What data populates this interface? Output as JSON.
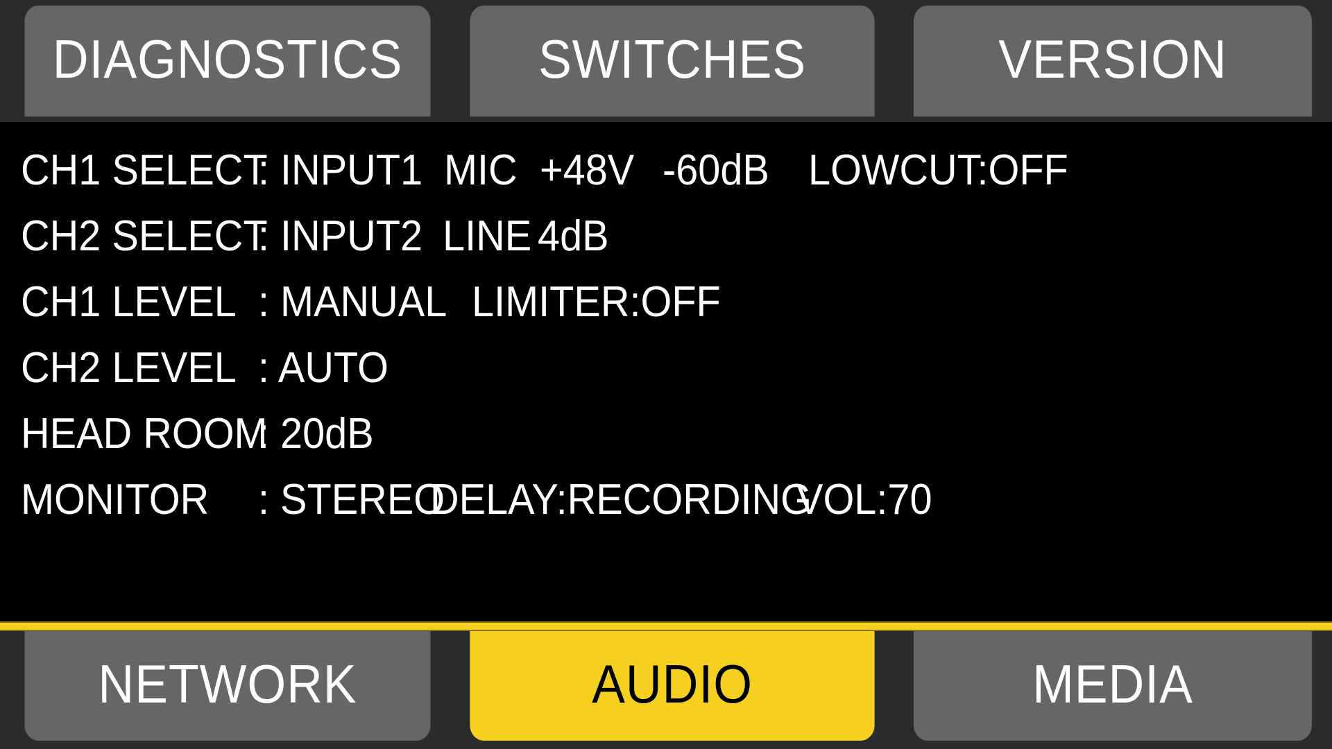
{
  "colors": {
    "panel_background": "#000000",
    "tab_inactive": "#666666",
    "tab_active": "#f5d020",
    "tab_active_text": "#000000",
    "text": "#ffffff",
    "chrome_background": "#2b2b2b",
    "divider": "#f5d020"
  },
  "top_tabs": [
    {
      "label": "DIAGNOSTICS",
      "active": false
    },
    {
      "label": "SWITCHES",
      "active": false
    },
    {
      "label": "VERSION",
      "active": false
    }
  ],
  "bottom_tabs": [
    {
      "label": "NETWORK",
      "active": false
    },
    {
      "label": "AUDIO",
      "active": true
    },
    {
      "label": "MEDIA",
      "active": false
    }
  ],
  "audio_settings": [
    {
      "label": "CH1 SELECT",
      "value": ": INPUT1",
      "extras": [
        "MIC",
        "+48V",
        "-60dB",
        "LOWCUT:OFF"
      ]
    },
    {
      "label": "CH2 SELECT",
      "value": ": INPUT2",
      "extras": [
        "LINE",
        "4dB"
      ]
    },
    {
      "label": "CH1 LEVEL",
      "value": ": MANUAL",
      "extras": [
        "LIMITER:OFF"
      ]
    },
    {
      "label": "CH2 LEVEL",
      "value": ": AUTO",
      "extras": []
    },
    {
      "label": "HEAD ROOM",
      "value": ": 20dB",
      "extras": []
    },
    {
      "label": "MONITOR",
      "value": ": STEREO",
      "extras": [
        "DELAY:RECORDING",
        "VOL:70"
      ]
    }
  ]
}
